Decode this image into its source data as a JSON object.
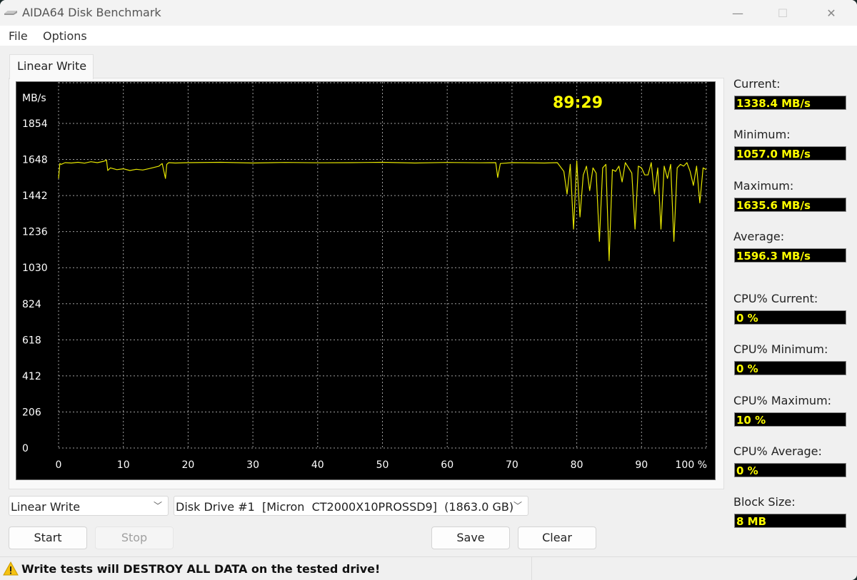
{
  "window": {
    "title": "AIDA64 Disk Benchmark",
    "controls": {
      "minimize": "—",
      "maximize": "☐",
      "close": "✕"
    }
  },
  "menu": [
    {
      "label": "File"
    },
    {
      "label": "Options"
    }
  ],
  "tabs": [
    {
      "label": "Linear Write",
      "active": true
    }
  ],
  "chart": {
    "elapsed": "89:29",
    "colors": {
      "background": "#000000",
      "line": "#e6e600",
      "grid": "#a0a0a0",
      "text": "#ffffff",
      "timer": "#ffff00"
    }
  },
  "chart_data": {
    "type": "line",
    "title": "Linear Write",
    "ylabel": "MB/s",
    "xlabel": "%",
    "ylim": [
      0,
      1854
    ],
    "xlim": [
      0,
      100
    ],
    "y_ticks": [
      "1854",
      "1648",
      "1442",
      "1236",
      "1030",
      "824",
      "618",
      "412",
      "206",
      "0"
    ],
    "x_ticks": [
      "0",
      "10",
      "20",
      "30",
      "40",
      "50",
      "60",
      "70",
      "80",
      "90",
      "100 %"
    ],
    "grid": true,
    "annotation": "89:29",
    "series": [
      {
        "name": "Linear Write",
        "x": [
          0,
          0.2,
          0.4,
          1,
          2,
          3,
          4,
          5,
          6,
          7,
          7.4,
          7.6,
          8,
          9,
          10,
          11,
          12,
          13,
          14,
          15,
          15.5,
          16,
          16.5,
          16.7,
          17,
          18,
          20,
          25,
          30,
          35,
          40,
          45,
          50,
          55,
          60,
          65,
          67.5,
          67.8,
          68.2,
          70,
          75,
          77,
          78,
          78.5,
          79,
          79.5,
          80,
          80.5,
          81,
          81.5,
          82,
          82.5,
          83,
          83.5,
          84,
          84.5,
          85,
          85.5,
          86,
          86.5,
          87,
          87.5,
          88,
          88.5,
          89,
          89.5,
          90,
          90.5,
          91,
          91.5,
          92,
          92.5,
          93,
          93.5,
          94,
          94.5,
          95,
          95.5,
          96,
          96.5,
          97,
          97.5,
          98,
          98.5,
          99,
          99.5,
          100
        ],
        "values": [
          1540,
          1625,
          1620,
          1630,
          1628,
          1632,
          1627,
          1635,
          1630,
          1638,
          1645,
          1585,
          1600,
          1590,
          1595,
          1585,
          1592,
          1588,
          1596,
          1605,
          1610,
          1625,
          1540,
          1620,
          1630,
          1628,
          1630,
          1632,
          1628,
          1631,
          1629,
          1630,
          1632,
          1628,
          1631,
          1629,
          1630,
          1545,
          1625,
          1630,
          1628,
          1630,
          1580,
          1450,
          1620,
          1250,
          1640,
          1320,
          1560,
          1610,
          1470,
          1600,
          1570,
          1180,
          1600,
          1620,
          1070,
          1590,
          1580,
          1610,
          1520,
          1630,
          1600,
          1570,
          1250,
          1610,
          1600,
          1560,
          1560,
          1630,
          1450,
          1600,
          1250,
          1610,
          1540,
          1620,
          1180,
          1600,
          1620,
          1610,
          1630,
          1580,
          1500,
          1610,
          1400,
          1600,
          1590
        ]
      }
    ]
  },
  "stats": [
    {
      "label": "Current:",
      "value": "1338.4 MB/s"
    },
    {
      "label": "Minimum:",
      "value": "1057.0 MB/s"
    },
    {
      "label": "Maximum:",
      "value": "1635.6 MB/s"
    },
    {
      "label": "Average:",
      "value": "1596.3 MB/s"
    },
    {
      "label": "CPU% Current:",
      "value": "0 %"
    },
    {
      "label": "CPU% Minimum:",
      "value": "0 %"
    },
    {
      "label": "CPU% Maximum:",
      "value": "10 %"
    },
    {
      "label": "CPU% Average:",
      "value": "0 %"
    },
    {
      "label": "Block Size:",
      "value": "8 MB"
    }
  ],
  "controls": {
    "test_select": {
      "value": "Linear Write"
    },
    "drive_select": {
      "value": "Disk Drive #1  [Micron  CT2000X10PROSSD9]  (1863.0 GB)"
    },
    "start": "Start",
    "stop": "Stop",
    "save": "Save",
    "clear": "Clear"
  },
  "status": {
    "warning": "Write tests will DESTROY ALL DATA on the tested drive!"
  }
}
